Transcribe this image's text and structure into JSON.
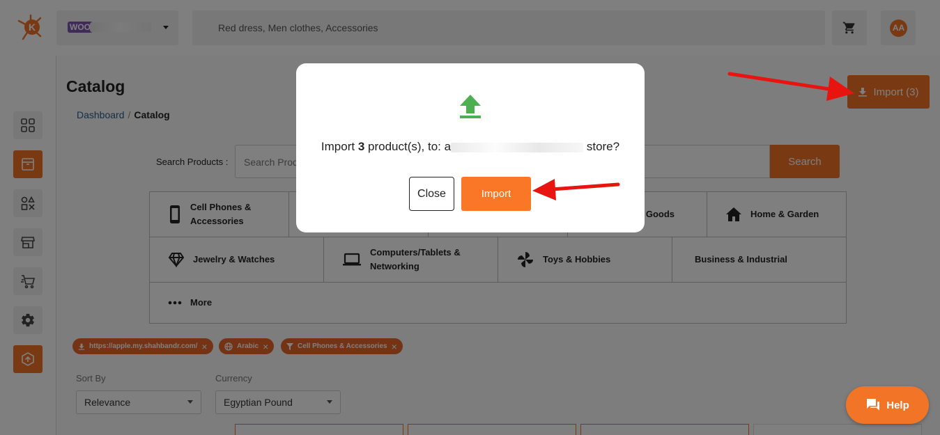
{
  "header": {
    "store_badge": "WOO",
    "search_placeholder": "Red dress, Men clothes, Accessories",
    "avatar_initials": "AA"
  },
  "page": {
    "title": "Catalog",
    "breadcrumb": {
      "home": "Dashboard",
      "separator": "/",
      "current": "Catalog"
    },
    "import_button": "Import (3)",
    "search_label": "Search Products :",
    "search_placeholder": "Search Produ",
    "search_button": "Search"
  },
  "categories": [
    {
      "label": "Cell Phones & Accessories",
      "icon": "phone-icon"
    },
    {
      "label": "Goods",
      "icon": "none"
    },
    {
      "label": "Home & Garden",
      "icon": "home-icon"
    },
    {
      "label": "Jewelry & Watches",
      "icon": "diamond-icon"
    },
    {
      "label": "Computers/Tablets & Networking",
      "icon": "laptop-icon"
    },
    {
      "label": "Toys & Hobbies",
      "icon": "pinwheel-icon"
    },
    {
      "label": "Business & Industrial",
      "icon": "none"
    },
    {
      "label": "More",
      "icon": "more-dots-icon"
    }
  ],
  "filters": [
    {
      "label": "https://apple.my.shahbandr.com/",
      "icon": "download-icon"
    },
    {
      "label": "Arabic",
      "icon": "globe-icon"
    },
    {
      "label": "Cell Phones & Accessories",
      "icon": "filter-icon"
    }
  ],
  "sort": {
    "label": "Sort By",
    "value": "Relevance"
  },
  "currency": {
    "label": "Currency",
    "value": "Egyptian Pound"
  },
  "help_button": "Help",
  "modal": {
    "msg_prefix": "Import",
    "count": "3",
    "msg_middle": "product(s), to:",
    "store_initial": "a",
    "msg_suffix": "store?",
    "close_label": "Close",
    "import_label": "Import"
  },
  "colors": {
    "accent": "#f27527",
    "upload_icon": "#4caf50",
    "annotation_arrow": "#e8140f",
    "woo_badge": "#7f54b3"
  }
}
